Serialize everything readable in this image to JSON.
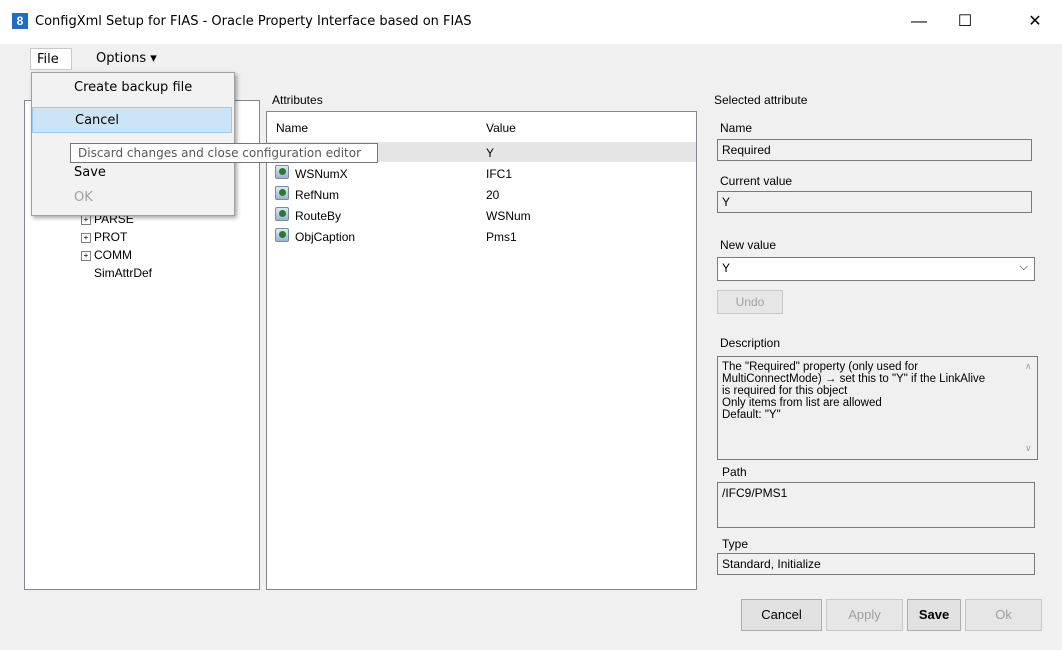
{
  "window": {
    "title": "ConfigXml Setup for FIAS - Oracle Property Interface based on FIAS",
    "minimize": "—",
    "maximize": "☐",
    "close": "✕"
  },
  "menubar": {
    "file": "File ▾",
    "options": "Options ▾"
  },
  "file_menu": {
    "items": [
      {
        "label": "Create backup file"
      },
      {
        "label": "Cancel"
      },
      {
        "label": "Save"
      },
      {
        "label": "OK"
      }
    ],
    "tooltip": "Discard changes and close configuration editor"
  },
  "tree": {
    "nodes": [
      {
        "label": "PARSE",
        "expander": "+"
      },
      {
        "label": "PROT",
        "expander": "+"
      },
      {
        "label": "COMM",
        "expander": "+"
      },
      {
        "label": "SimAttrDef",
        "expander": ""
      }
    ]
  },
  "attributes": {
    "group_label": "Attributes",
    "col_name": "Name",
    "col_value": "Value",
    "rows": [
      {
        "name": "",
        "value": "Y"
      },
      {
        "name": "WSNumX",
        "value": "IFC1"
      },
      {
        "name": "RefNum",
        "value": "20"
      },
      {
        "name": "RouteBy",
        "value": "WSNum"
      },
      {
        "name": "ObjCaption",
        "value": "Pms1"
      }
    ]
  },
  "selected": {
    "group_label": "Selected attribute",
    "name_label": "Name",
    "name_value": "Required",
    "current_label": "Current value",
    "current_value": "Y",
    "new_label": "New value",
    "new_value": "Y",
    "undo": "Undo",
    "description_label": "Description",
    "description": "The \"Required\" property (only used for\nMultiConnectMode) → set this to \"Y\" if the LinkAlive\nis required for this object\nOnly items from list are allowed\nDefault: \"Y\"",
    "path_label": "Path",
    "path_value": "/IFC9/PMS1",
    "type_label": "Type",
    "type_value": "Standard, Initialize"
  },
  "buttons": {
    "cancel": "Cancel",
    "apply": "Apply",
    "save": "Save",
    "ok": "Ok"
  }
}
